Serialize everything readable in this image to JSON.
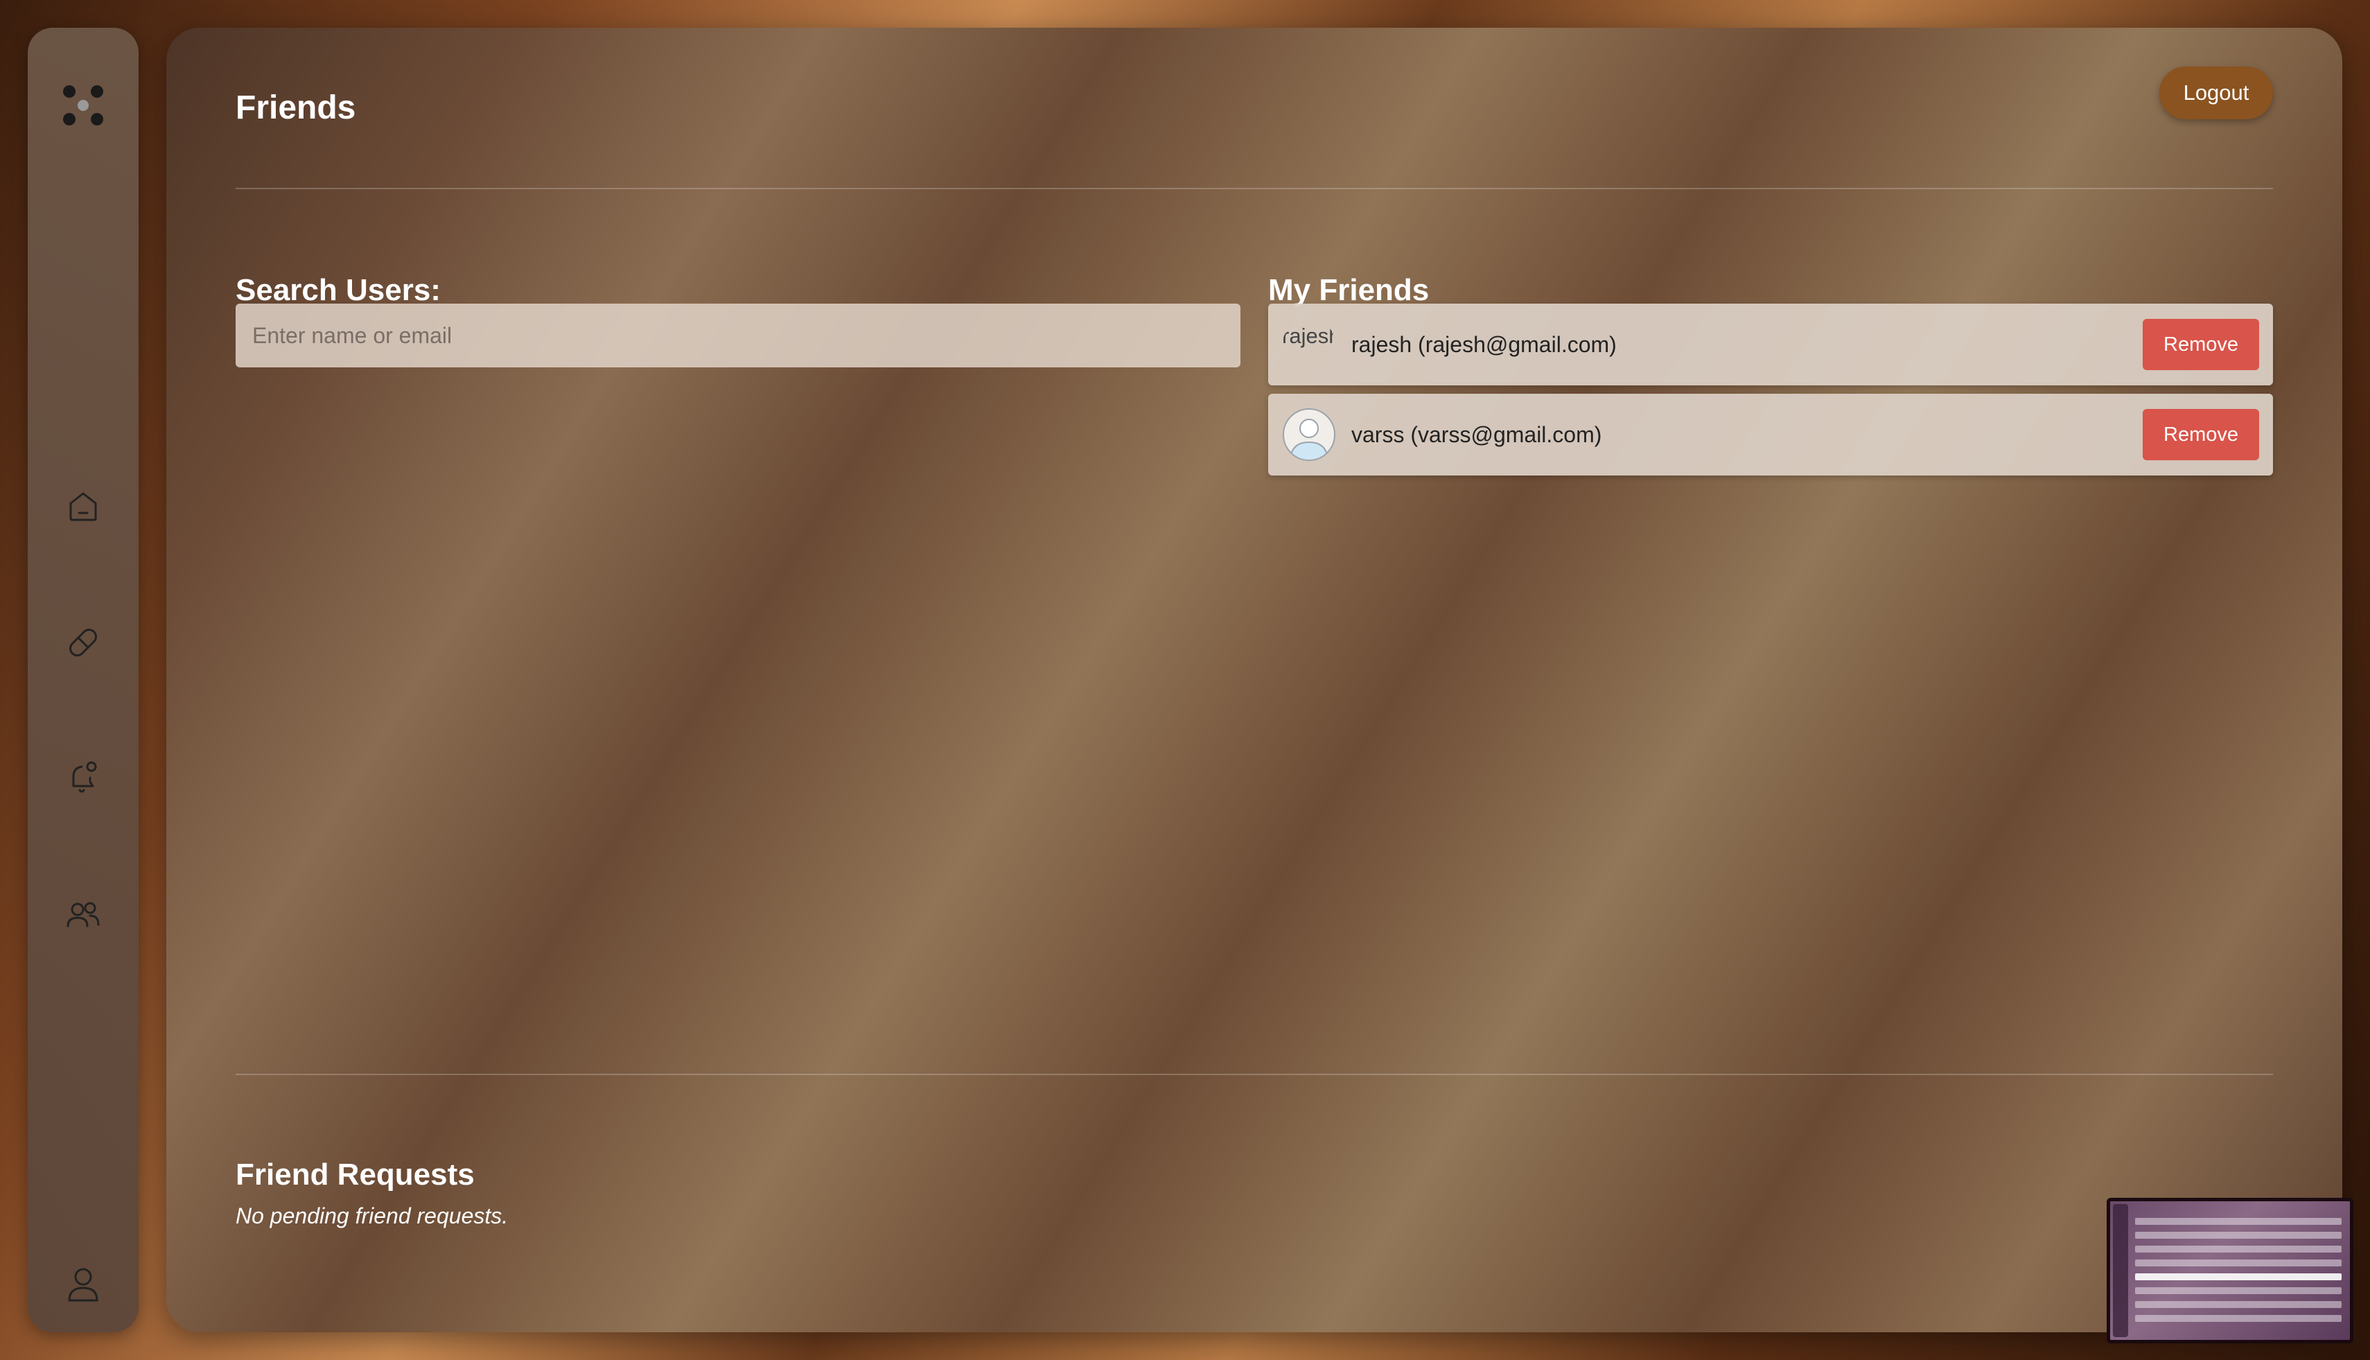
{
  "app": {
    "page_title": "Friends",
    "logout_label": "Logout"
  },
  "sidebar": {
    "logo_icon": "grid-dots-logo",
    "items": [
      {
        "name": "home",
        "icon": "home-icon"
      },
      {
        "name": "pill",
        "icon": "pill-icon"
      },
      {
        "name": "notifications",
        "icon": "bell-icon"
      },
      {
        "name": "friends",
        "icon": "users-icon"
      },
      {
        "name": "profile",
        "icon": "user-icon"
      }
    ]
  },
  "search": {
    "title": "Search Users:",
    "placeholder": "Enter name or email",
    "value": ""
  },
  "friends": {
    "title": "My Friends",
    "remove_label": "Remove",
    "list": [
      {
        "display": "rajesh (rajesh@gmail.com)",
        "avatar_alt": "rajesh",
        "avatar_type": "broken-image"
      },
      {
        "display": "varss (varss@gmail.com)",
        "avatar_alt": "varss",
        "avatar_type": "default-avatar"
      }
    ]
  },
  "requests": {
    "title": "Friend Requests",
    "empty_text": "No pending friend requests."
  },
  "colors": {
    "logout_bg": "#8b531f",
    "remove_bg": "#d9544a",
    "text": "#ffffff"
  }
}
